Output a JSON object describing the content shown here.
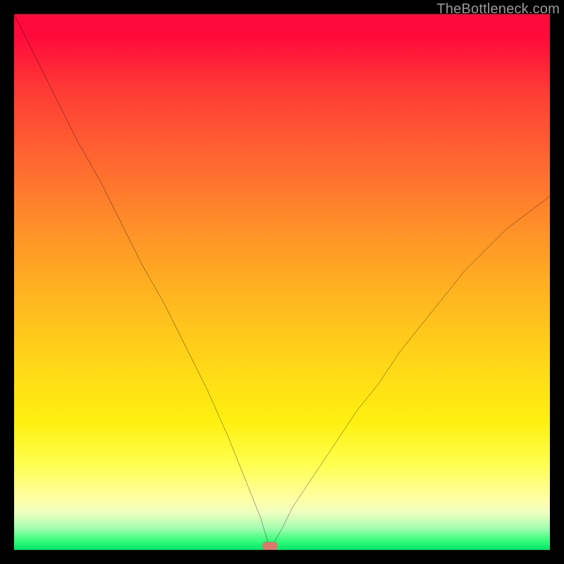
{
  "watermark": "TheBottleneck.com",
  "marker": {
    "x_pct": 47.8,
    "y_pct": 99.2
  },
  "chart_data": {
    "type": "line",
    "title": "",
    "xlabel": "",
    "ylabel": "",
    "xlim": [
      0,
      100
    ],
    "ylim": [
      0,
      100
    ],
    "grid": false,
    "legend_position": "none",
    "series": [
      {
        "name": "bottleneck-curve",
        "x": [
          0,
          4,
          8,
          12,
          16,
          20,
          24,
          28,
          32,
          36,
          40,
          42,
          44,
          46,
          47.8,
          50,
          52,
          56,
          60,
          64,
          68,
          72,
          76,
          80,
          84,
          88,
          92,
          96,
          100
        ],
        "y": [
          100,
          92,
          84,
          76,
          69,
          61,
          53,
          46,
          38,
          30,
          21,
          16,
          11,
          6,
          0,
          4,
          8,
          14,
          20,
          26,
          31,
          37,
          42,
          47,
          52,
          56,
          60,
          63,
          66
        ]
      }
    ],
    "background_gradient": {
      "stops": [
        {
          "pct": 0,
          "color": "#ff0a3a"
        },
        {
          "pct": 14,
          "color": "#ff3a35"
        },
        {
          "pct": 28,
          "color": "#ff6a30"
        },
        {
          "pct": 40,
          "color": "#ff9028"
        },
        {
          "pct": 52,
          "color": "#ffb420"
        },
        {
          "pct": 64,
          "color": "#ffd418"
        },
        {
          "pct": 76,
          "color": "#fff010"
        },
        {
          "pct": 90,
          "color": "#ffffa0"
        },
        {
          "pct": 96,
          "color": "#a0ffb0"
        },
        {
          "pct": 100,
          "color": "#00e868"
        }
      ]
    },
    "annotations": [
      {
        "type": "pill-marker",
        "x": 47.8,
        "y": 0,
        "color": "#d87a6a"
      }
    ]
  }
}
